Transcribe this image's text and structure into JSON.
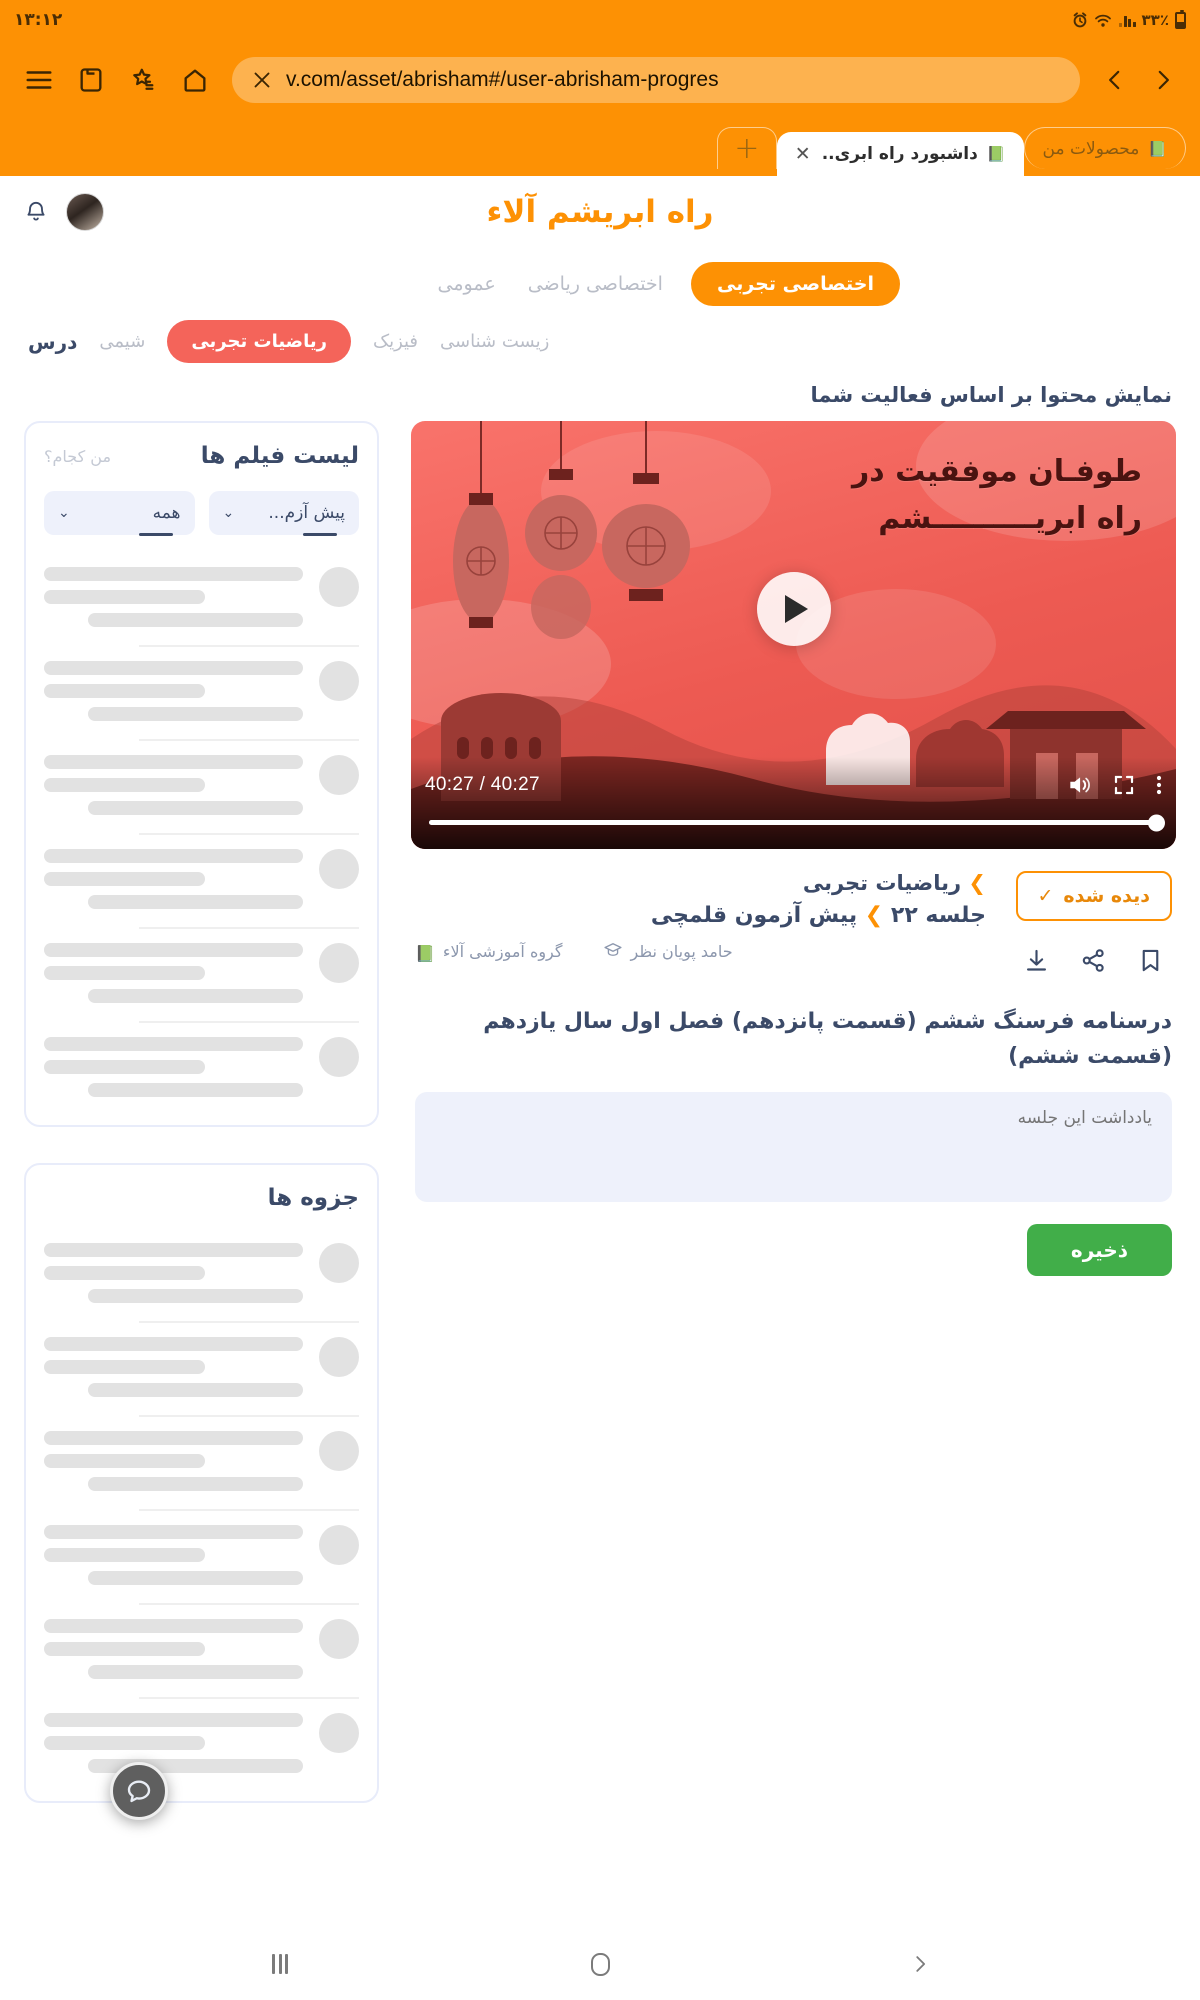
{
  "status_bar": {
    "battery_percent": "٪٣٣",
    "clock": "۱۳:۱۲",
    "icons": [
      "battery-icon",
      "signal-icon",
      "wifi-icon",
      "alarm-icon"
    ]
  },
  "browser": {
    "url": "v.com/asset/abrisham#/user-abrisham-progres",
    "toolbar_icons": [
      "menu-icon",
      "tabs-icon",
      "bookmark-star-icon",
      "home-icon"
    ],
    "back_label": "‹",
    "forward_label": "›",
    "new_tab_label": "+",
    "tabs": [
      {
        "title": "محصولات من",
        "active": false,
        "favicon": "alaa-favicon"
      },
      {
        "title": "داشبورد راه ابری..",
        "active": true,
        "favicon": "alaa-favicon",
        "close_label": "✕"
      }
    ]
  },
  "site": {
    "logo": "راه ابریشم آلاء",
    "avatar_name": "avatar",
    "bell_name": "notifications-bell"
  },
  "filters": {
    "items": [
      {
        "label": "اختصاصی تجربی",
        "active": true
      },
      {
        "label": "اختصاصی ریاضی",
        "active": false
      },
      {
        "label": "عمومی",
        "active": false
      }
    ]
  },
  "subjects": {
    "label": "درس",
    "items": [
      {
        "label": "زیست شناسی",
        "active": false
      },
      {
        "label": "فیزیک",
        "active": false
      },
      {
        "label": "ریاضیات تجربی",
        "active": true
      },
      {
        "label": "شیمی",
        "active": false
      }
    ]
  },
  "section_title": "نمایش محتوا بر اساس فعالیت شما",
  "video": {
    "title_line1": "طوفـان موفقیت در",
    "title_line2": "راه ابریــــــــــشم",
    "time_display": "40:27 / 40:27",
    "progress_percent": 100,
    "controls": [
      "play-button",
      "volume-icon",
      "fullscreen-icon",
      "more-options-icon"
    ]
  },
  "content_meta": {
    "breadcrumb_subject": "ریاضیات تجربی",
    "breadcrumb_sep": "❯",
    "breadcrumb_course": "پیش آزمون قلمچی",
    "breadcrumb_session": "جلسه ۲۲",
    "publisher": "گروه آموزشی آلاء",
    "teacher": "حامد پویان نظر",
    "seen_label": "دیده شده",
    "seen_check": "✓",
    "action_icons": [
      "bookmark-icon",
      "share-icon",
      "download-icon"
    ]
  },
  "lesson": {
    "title": "درسنامه فرسنگ ششم (قسمت پانزدهم) فصل اول سال یازدهم (قسمت ششم)",
    "note_placeholder": "یادداشت این جلسه",
    "note_value": "",
    "save_label": "ذخیره"
  },
  "sidebar": {
    "films_card": {
      "title": "لیست فیلم ها",
      "link": "من کجام؟",
      "select_exam": "پیش آزم...",
      "select_all": "همه",
      "chevron": "⌄",
      "skeleton_rows": 6
    },
    "notes_card": {
      "title": "جزوه ها",
      "skeleton_rows": 6
    }
  },
  "floating": {
    "chat_icon": "chat-bubble-icon"
  },
  "android_nav": {
    "recents_label": "recents-button",
    "home_label": "home-button",
    "back_label": "❯"
  },
  "colors": {
    "brand_orange": "#FD9104",
    "accent_red": "#F4645A",
    "text_navy": "#3b4a68",
    "save_green": "#41AE49",
    "panel_blue": "#EEF1FB"
  }
}
